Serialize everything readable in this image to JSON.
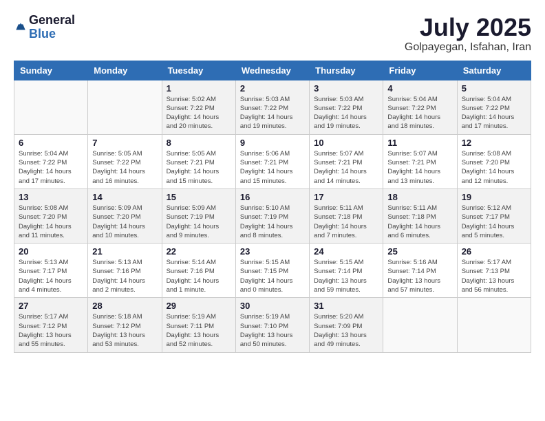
{
  "header": {
    "logo": {
      "general": "General",
      "blue": "Blue"
    },
    "title": "July 2025",
    "location": "Golpayegan, Isfahan, Iran"
  },
  "weekdays": [
    "Sunday",
    "Monday",
    "Tuesday",
    "Wednesday",
    "Thursday",
    "Friday",
    "Saturday"
  ],
  "weeks": [
    [
      {
        "day": null
      },
      {
        "day": null
      },
      {
        "day": "1",
        "sunrise": "Sunrise: 5:02 AM",
        "sunset": "Sunset: 7:22 PM",
        "daylight": "Daylight: 14 hours and 20 minutes."
      },
      {
        "day": "2",
        "sunrise": "Sunrise: 5:03 AM",
        "sunset": "Sunset: 7:22 PM",
        "daylight": "Daylight: 14 hours and 19 minutes."
      },
      {
        "day": "3",
        "sunrise": "Sunrise: 5:03 AM",
        "sunset": "Sunset: 7:22 PM",
        "daylight": "Daylight: 14 hours and 19 minutes."
      },
      {
        "day": "4",
        "sunrise": "Sunrise: 5:04 AM",
        "sunset": "Sunset: 7:22 PM",
        "daylight": "Daylight: 14 hours and 18 minutes."
      },
      {
        "day": "5",
        "sunrise": "Sunrise: 5:04 AM",
        "sunset": "Sunset: 7:22 PM",
        "daylight": "Daylight: 14 hours and 17 minutes."
      }
    ],
    [
      {
        "day": "6",
        "sunrise": "Sunrise: 5:04 AM",
        "sunset": "Sunset: 7:22 PM",
        "daylight": "Daylight: 14 hours and 17 minutes."
      },
      {
        "day": "7",
        "sunrise": "Sunrise: 5:05 AM",
        "sunset": "Sunset: 7:22 PM",
        "daylight": "Daylight: 14 hours and 16 minutes."
      },
      {
        "day": "8",
        "sunrise": "Sunrise: 5:05 AM",
        "sunset": "Sunset: 7:21 PM",
        "daylight": "Daylight: 14 hours and 15 minutes."
      },
      {
        "day": "9",
        "sunrise": "Sunrise: 5:06 AM",
        "sunset": "Sunset: 7:21 PM",
        "daylight": "Daylight: 14 hours and 15 minutes."
      },
      {
        "day": "10",
        "sunrise": "Sunrise: 5:07 AM",
        "sunset": "Sunset: 7:21 PM",
        "daylight": "Daylight: 14 hours and 14 minutes."
      },
      {
        "day": "11",
        "sunrise": "Sunrise: 5:07 AM",
        "sunset": "Sunset: 7:21 PM",
        "daylight": "Daylight: 14 hours and 13 minutes."
      },
      {
        "day": "12",
        "sunrise": "Sunrise: 5:08 AM",
        "sunset": "Sunset: 7:20 PM",
        "daylight": "Daylight: 14 hours and 12 minutes."
      }
    ],
    [
      {
        "day": "13",
        "sunrise": "Sunrise: 5:08 AM",
        "sunset": "Sunset: 7:20 PM",
        "daylight": "Daylight: 14 hours and 11 minutes."
      },
      {
        "day": "14",
        "sunrise": "Sunrise: 5:09 AM",
        "sunset": "Sunset: 7:20 PM",
        "daylight": "Daylight: 14 hours and 10 minutes."
      },
      {
        "day": "15",
        "sunrise": "Sunrise: 5:09 AM",
        "sunset": "Sunset: 7:19 PM",
        "daylight": "Daylight: 14 hours and 9 minutes."
      },
      {
        "day": "16",
        "sunrise": "Sunrise: 5:10 AM",
        "sunset": "Sunset: 7:19 PM",
        "daylight": "Daylight: 14 hours and 8 minutes."
      },
      {
        "day": "17",
        "sunrise": "Sunrise: 5:11 AM",
        "sunset": "Sunset: 7:18 PM",
        "daylight": "Daylight: 14 hours and 7 minutes."
      },
      {
        "day": "18",
        "sunrise": "Sunrise: 5:11 AM",
        "sunset": "Sunset: 7:18 PM",
        "daylight": "Daylight: 14 hours and 6 minutes."
      },
      {
        "day": "19",
        "sunrise": "Sunrise: 5:12 AM",
        "sunset": "Sunset: 7:17 PM",
        "daylight": "Daylight: 14 hours and 5 minutes."
      }
    ],
    [
      {
        "day": "20",
        "sunrise": "Sunrise: 5:13 AM",
        "sunset": "Sunset: 7:17 PM",
        "daylight": "Daylight: 14 hours and 4 minutes."
      },
      {
        "day": "21",
        "sunrise": "Sunrise: 5:13 AM",
        "sunset": "Sunset: 7:16 PM",
        "daylight": "Daylight: 14 hours and 2 minutes."
      },
      {
        "day": "22",
        "sunrise": "Sunrise: 5:14 AM",
        "sunset": "Sunset: 7:16 PM",
        "daylight": "Daylight: 14 hours and 1 minute."
      },
      {
        "day": "23",
        "sunrise": "Sunrise: 5:15 AM",
        "sunset": "Sunset: 7:15 PM",
        "daylight": "Daylight: 14 hours and 0 minutes."
      },
      {
        "day": "24",
        "sunrise": "Sunrise: 5:15 AM",
        "sunset": "Sunset: 7:14 PM",
        "daylight": "Daylight: 13 hours and 59 minutes."
      },
      {
        "day": "25",
        "sunrise": "Sunrise: 5:16 AM",
        "sunset": "Sunset: 7:14 PM",
        "daylight": "Daylight: 13 hours and 57 minutes."
      },
      {
        "day": "26",
        "sunrise": "Sunrise: 5:17 AM",
        "sunset": "Sunset: 7:13 PM",
        "daylight": "Daylight: 13 hours and 56 minutes."
      }
    ],
    [
      {
        "day": "27",
        "sunrise": "Sunrise: 5:17 AM",
        "sunset": "Sunset: 7:12 PM",
        "daylight": "Daylight: 13 hours and 55 minutes."
      },
      {
        "day": "28",
        "sunrise": "Sunrise: 5:18 AM",
        "sunset": "Sunset: 7:12 PM",
        "daylight": "Daylight: 13 hours and 53 minutes."
      },
      {
        "day": "29",
        "sunrise": "Sunrise: 5:19 AM",
        "sunset": "Sunset: 7:11 PM",
        "daylight": "Daylight: 13 hours and 52 minutes."
      },
      {
        "day": "30",
        "sunrise": "Sunrise: 5:19 AM",
        "sunset": "Sunset: 7:10 PM",
        "daylight": "Daylight: 13 hours and 50 minutes."
      },
      {
        "day": "31",
        "sunrise": "Sunrise: 5:20 AM",
        "sunset": "Sunset: 7:09 PM",
        "daylight": "Daylight: 13 hours and 49 minutes."
      },
      {
        "day": null
      },
      {
        "day": null
      }
    ]
  ]
}
